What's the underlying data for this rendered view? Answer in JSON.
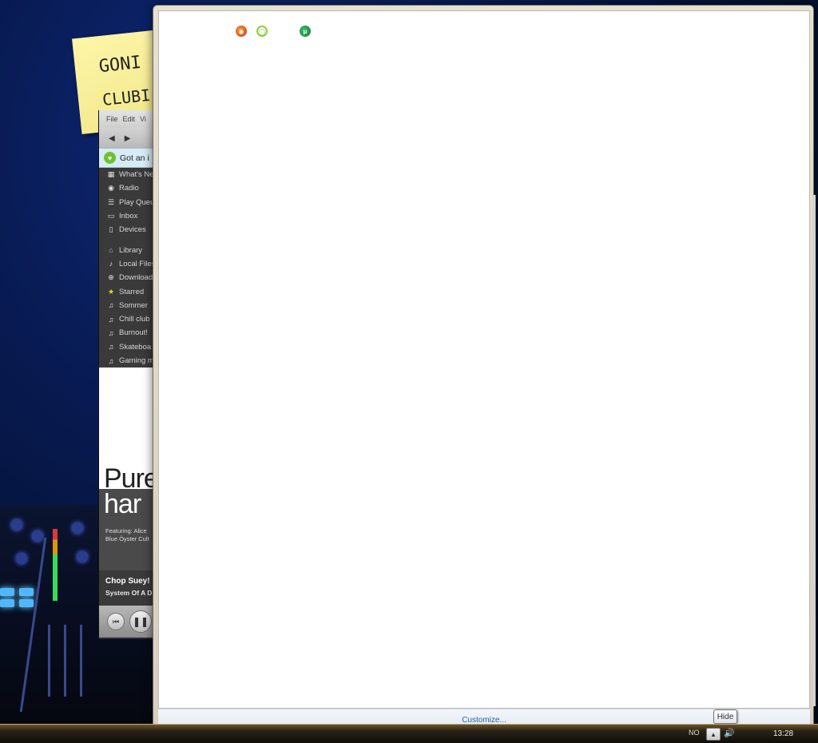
{
  "sticky_note": {
    "line1": "GONI",
    "line2": "CLUBI"
  },
  "spotify": {
    "menu": [
      "File",
      "Edit",
      "Vi"
    ],
    "nav": {
      "back": "◀",
      "forward": "▶"
    },
    "banner": "Got an i",
    "sidebar_top": [
      {
        "label": "What's Ne",
        "icon": "grid-icon",
        "glyph": "▦"
      },
      {
        "label": "Radio",
        "icon": "radio-icon",
        "glyph": "◉"
      },
      {
        "label": "Play Queu",
        "icon": "queue-icon",
        "glyph": "☰"
      },
      {
        "label": "Inbox",
        "icon": "inbox-icon",
        "glyph": "▭"
      },
      {
        "label": "Devices",
        "icon": "device-icon",
        "glyph": "▯"
      }
    ],
    "sidebar_main": [
      {
        "label": "Library",
        "icon": "home-icon",
        "glyph": "⌂"
      },
      {
        "label": "Local Files",
        "icon": "file-icon",
        "glyph": "♪"
      },
      {
        "label": "Download",
        "icon": "download-icon",
        "glyph": "⊕"
      },
      {
        "label": "Starred",
        "icon": "star-icon",
        "glyph": "★"
      },
      {
        "label": "Sommer",
        "icon": "playlist-icon",
        "glyph": "♫"
      },
      {
        "label": "Chill club",
        "icon": "playlist-icon",
        "glyph": "♫"
      },
      {
        "label": "Burnout!",
        "icon": "playlist-icon",
        "glyph": "♫"
      },
      {
        "label": "Skateboa",
        "icon": "playlist-icon",
        "glyph": "♫"
      },
      {
        "label": "Gaming m",
        "icon": "playlist-icon",
        "glyph": "♫"
      }
    ],
    "ad": {
      "line1": "Pure",
      "line2": "har",
      "featuring": "Featuring: Alice",
      "featuring2": "Blue Öyster Cult"
    },
    "now_playing": {
      "title": "Chop Suey!",
      "artist": "System Of A D"
    },
    "controls": {
      "prev": "⏮",
      "pause": "❚❚"
    }
  },
  "notification_area": {
    "customize_label": "Customize...",
    "icons": [
      {
        "name": "avast-icon",
        "glyph": "◉"
      },
      {
        "name": "lime-icon",
        "glyph": "◯"
      },
      {
        "name": "utorrent-icon",
        "glyph": "μ"
      }
    ]
  },
  "taskbar": {
    "language": "NO",
    "show_hidden_glyph": "▲",
    "volume_glyph": "🔊",
    "clock": "13:28",
    "tooltip": "Hide"
  }
}
